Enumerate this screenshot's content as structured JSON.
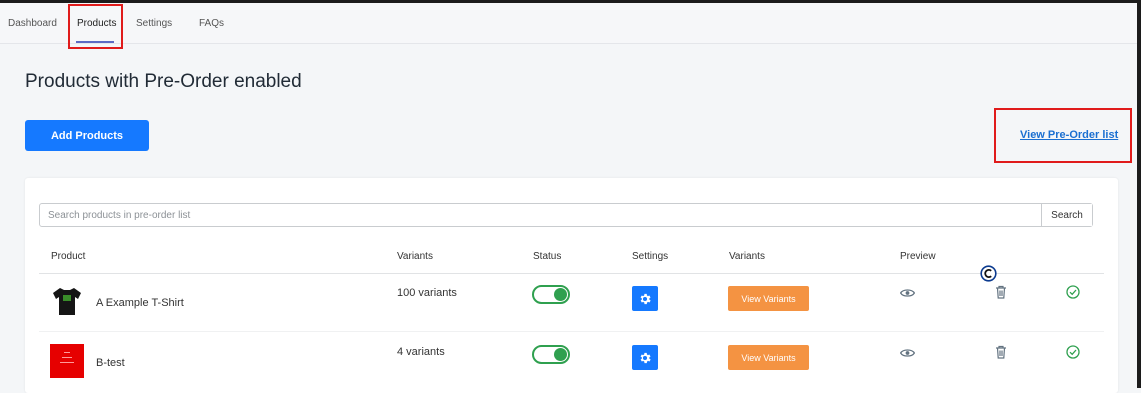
{
  "nav": {
    "tabs": [
      {
        "label": "Dashboard"
      },
      {
        "label": "Products"
      },
      {
        "label": "Settings"
      },
      {
        "label": "FAQs"
      }
    ],
    "active": "Products"
  },
  "page": {
    "title": "Products with Pre-Order enabled",
    "add_products_label": "Add Products",
    "view_list_label": "View Pre-Order list"
  },
  "search": {
    "placeholder": "Search products in pre-order list",
    "value": "",
    "button_label": "Search"
  },
  "table": {
    "headers": [
      "Product",
      "Variants",
      "Status",
      "Settings",
      "Variants",
      "Preview"
    ],
    "rows": [
      {
        "name": "A Example T-Shirt",
        "variants": "100 variants",
        "status_enabled": true,
        "view_variants_label": "View Variants"
      },
      {
        "name": "B-test",
        "variants": "4 variants",
        "status_enabled": true,
        "view_variants_label": "View Variants"
      }
    ]
  },
  "colors": {
    "primary": "#1579ff",
    "orange": "#f49342",
    "success": "#2fa04f",
    "highlight": "#e01b1b"
  }
}
